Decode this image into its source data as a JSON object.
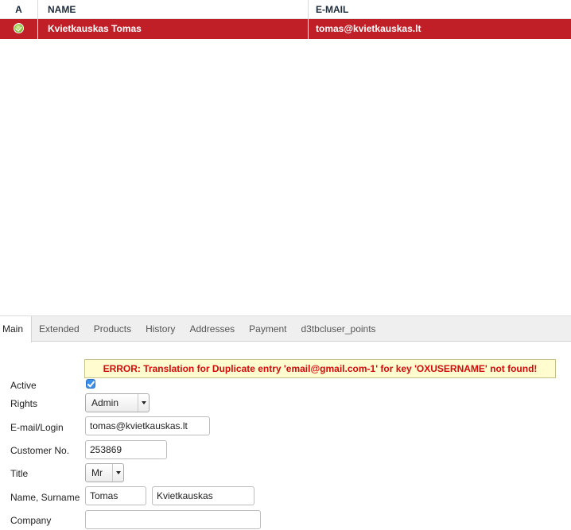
{
  "list": {
    "columns": {
      "active": "A",
      "name": "NAME",
      "email": "E-MAIL"
    },
    "rows": [
      {
        "active": true,
        "name": "Kvietkauskas Tomas",
        "email": "tomas@kvietkauskas.lt"
      }
    ],
    "selected_row_color": "#c01f28"
  },
  "tabs": [
    {
      "label": "Main",
      "active": true
    },
    {
      "label": "Extended"
    },
    {
      "label": "Products"
    },
    {
      "label": "History"
    },
    {
      "label": "Addresses"
    },
    {
      "label": "Payment"
    },
    {
      "label": "d3tbcluser_points"
    }
  ],
  "error": {
    "message": "ERROR: Translation for Duplicate entry 'email@gmail.com-1' for key 'OXUSERNAME' not found!",
    "color": "#d20b0b"
  },
  "form": {
    "active": {
      "label": "Active",
      "checked": true
    },
    "rights": {
      "label": "Rights",
      "value": "Admin"
    },
    "email": {
      "label": "E-mail/Login",
      "value": "tomas@kvietkauskas.lt"
    },
    "customer_no": {
      "label": "Customer No.",
      "value": "253869"
    },
    "title": {
      "label": "Title",
      "value": "Mr"
    },
    "name": {
      "label": "Name, Surname",
      "first": "Tomas",
      "last": "Kvietkauskas"
    },
    "company": {
      "label": "Company",
      "value": ""
    }
  },
  "icons": {
    "active_indicator": "active-check-icon",
    "checkbox": "checkmark-icon",
    "select_arrow": "chevron-down-icon"
  }
}
